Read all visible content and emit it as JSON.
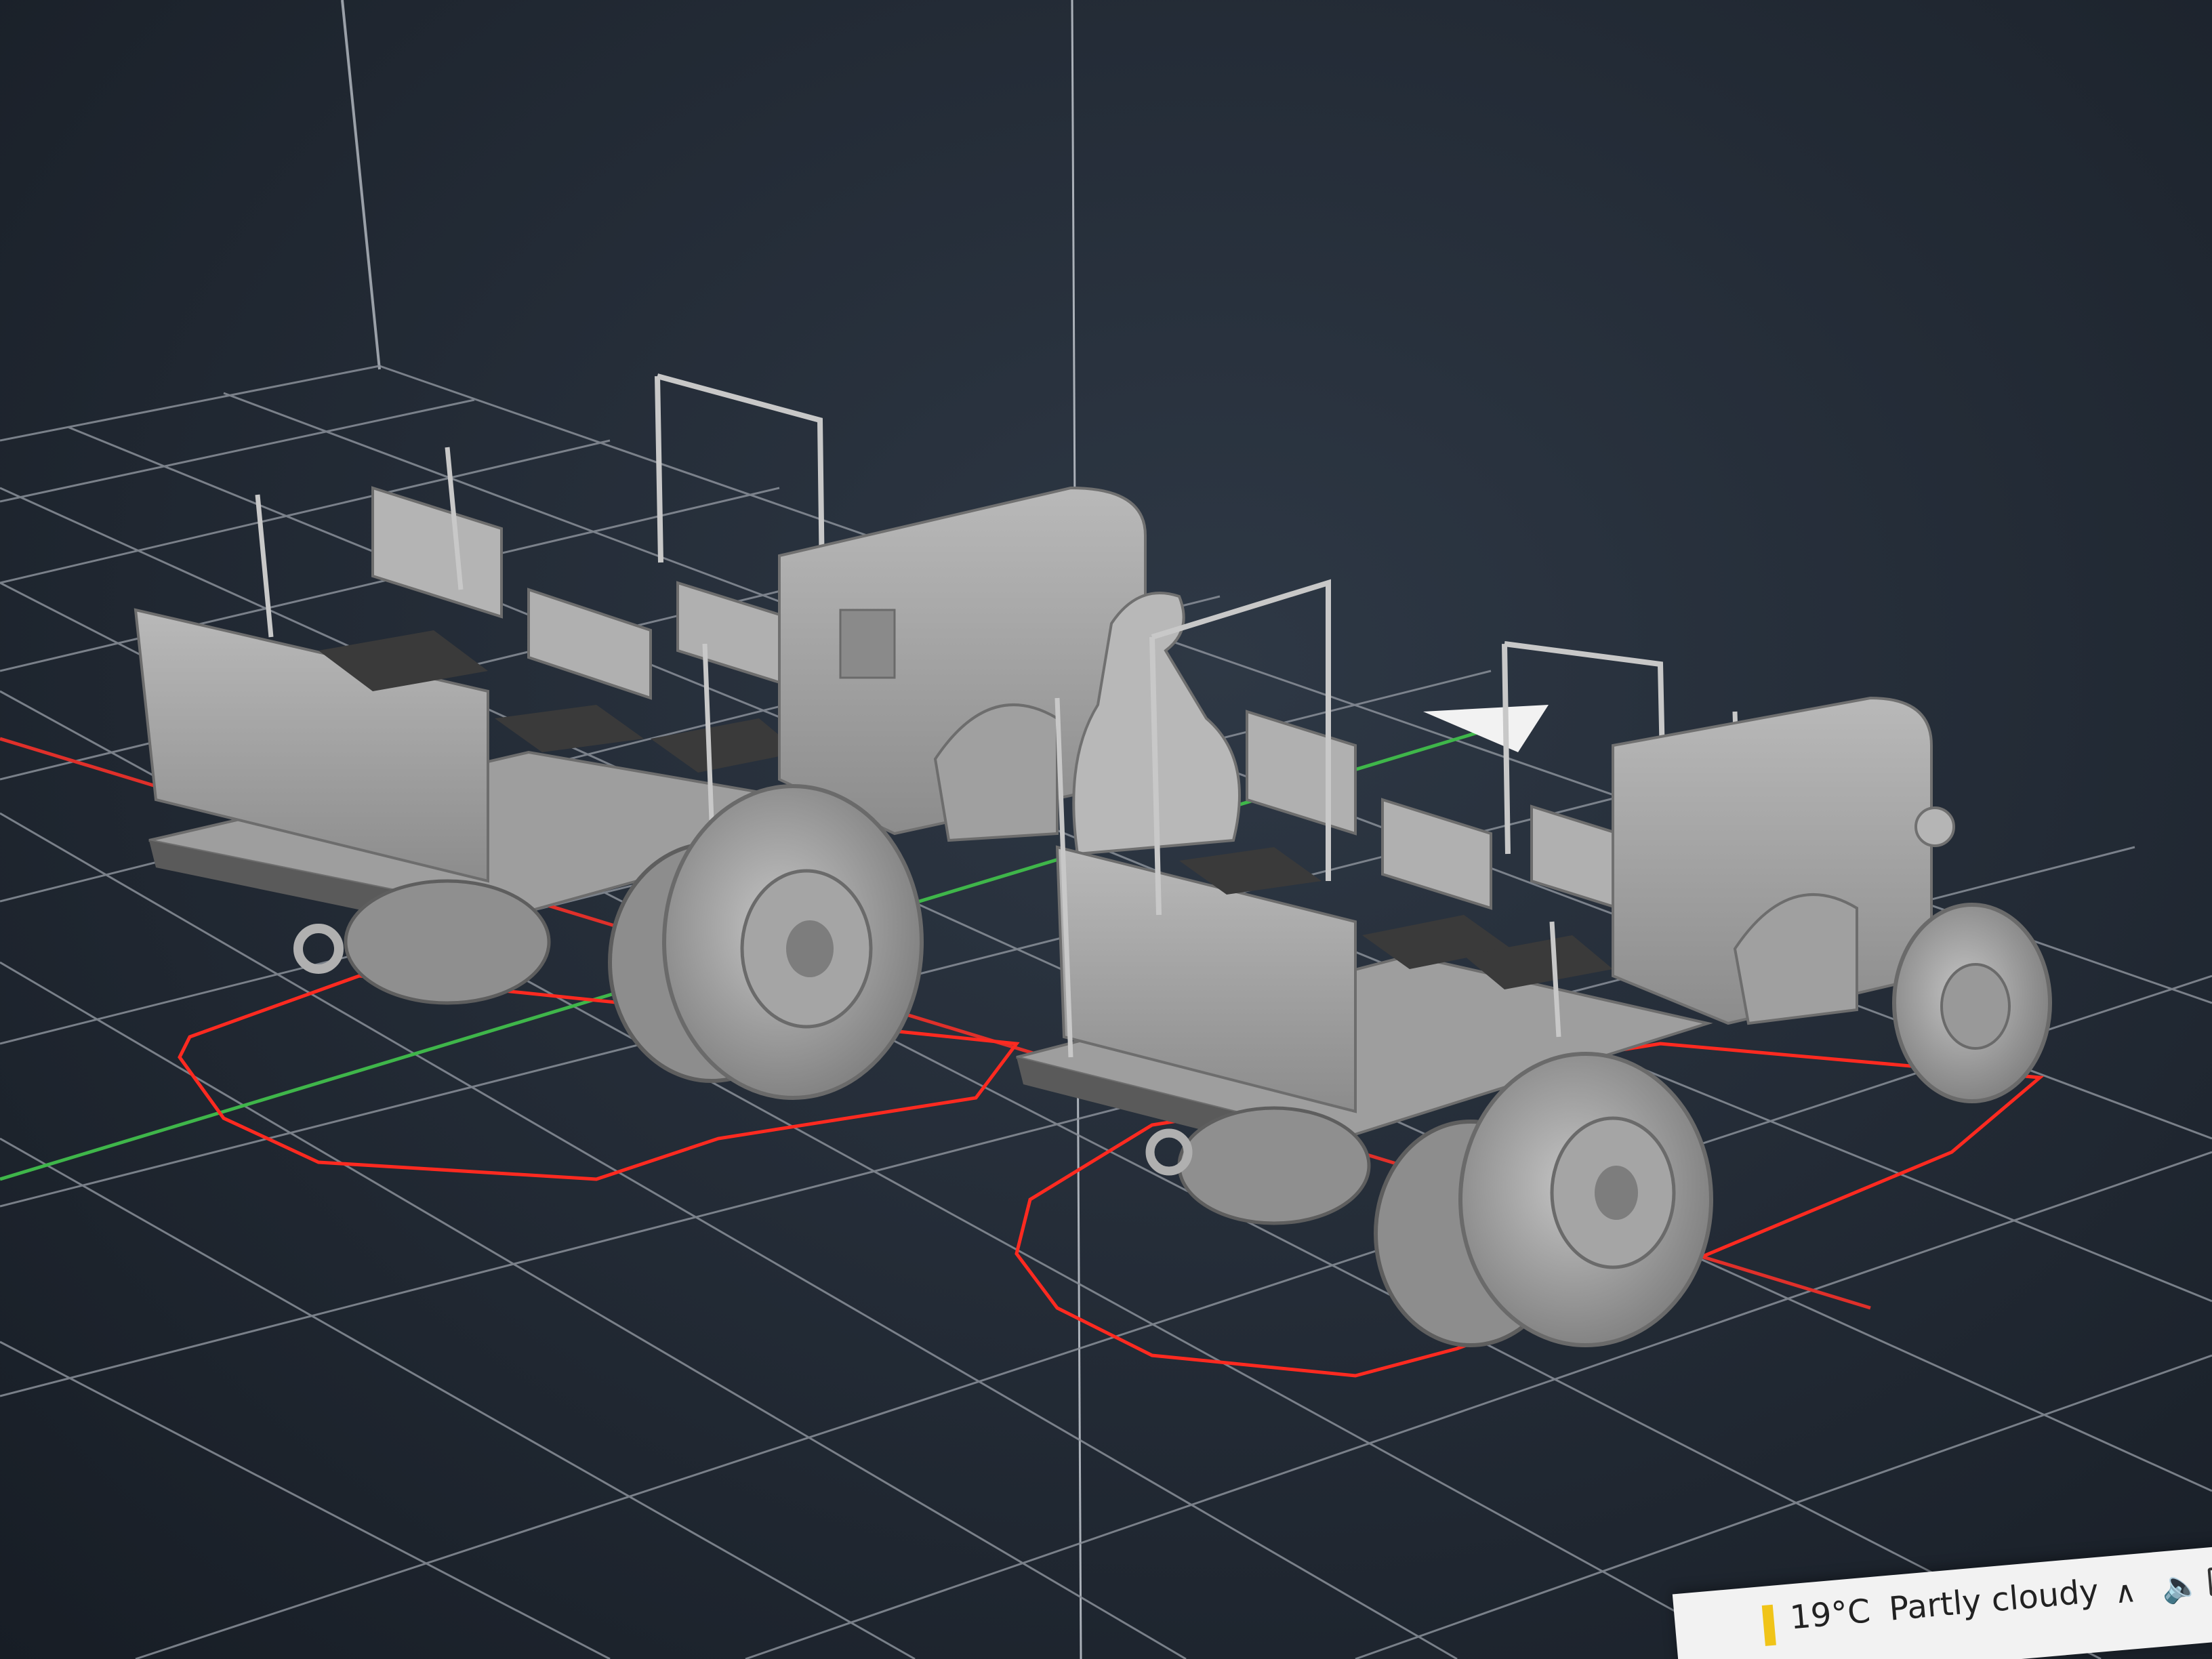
{
  "taskbar": {
    "temperature": "19°C",
    "condition": "Partly cloudy",
    "tray_icons": [
      "chevron-up-icon",
      "speaker-icon",
      "notifications-icon"
    ]
  },
  "viewport": {
    "objects": [
      "tractor-with-benches",
      "tractor-with-benches-and-driver"
    ]
  },
  "colors": {
    "background": "#242c37",
    "grid": "#7d8590",
    "x_axis": "#e0302a",
    "y_axis": "#3fb64a",
    "model": "#a7a7a7",
    "selection_outline": "#ff2a20"
  }
}
